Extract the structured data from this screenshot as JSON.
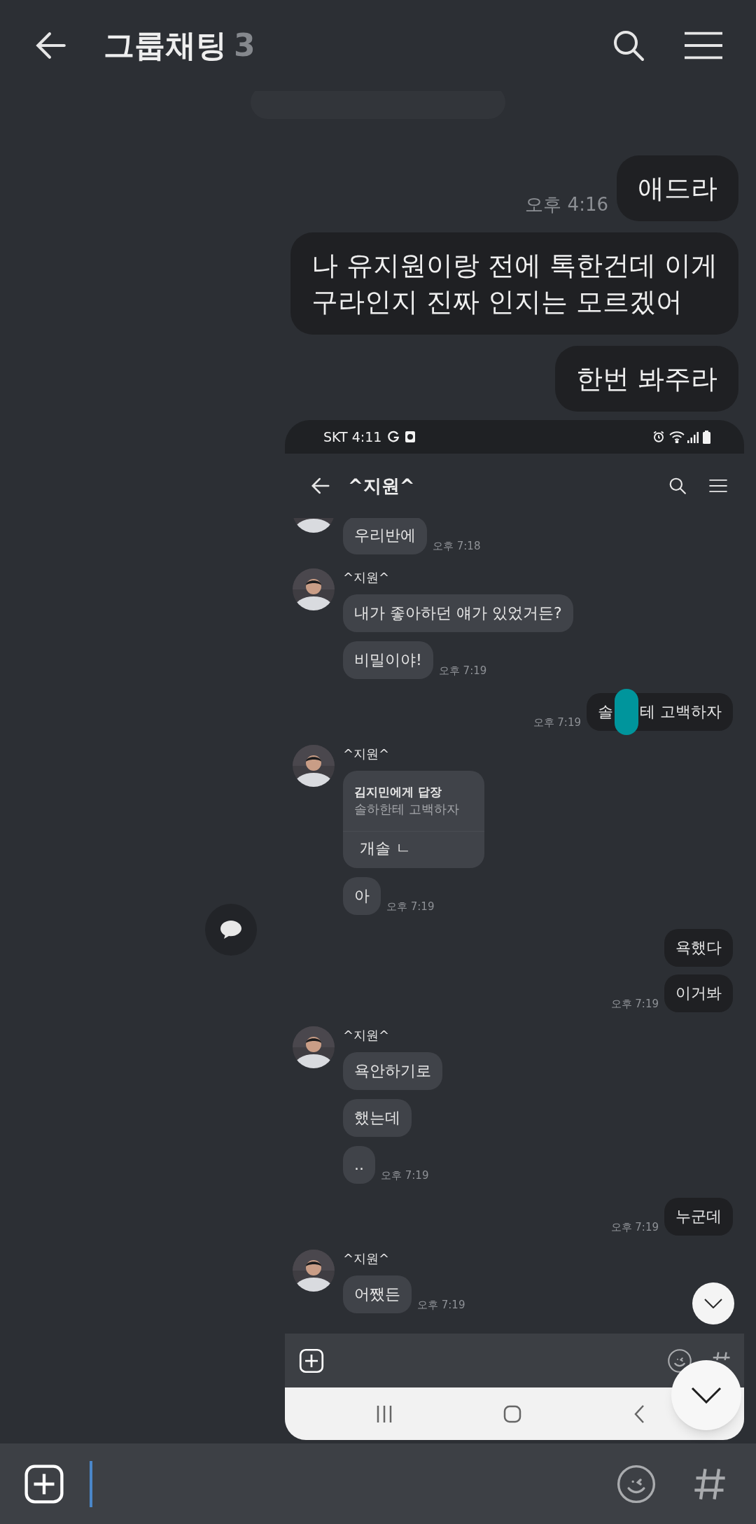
{
  "header": {
    "title": "그룹채팅",
    "member_count": "3"
  },
  "messages": [
    {
      "text": "애드라",
      "time": "오후 4:16"
    },
    {
      "lines": [
        "나 유지원이랑 전에 톡한건데 이게",
        "구라인지 진짜 인지는 모르겠어"
      ]
    },
    {
      "text": "한번 봐주라"
    }
  ],
  "screenshot": {
    "status_bar": {
      "text": "SKT 4:11"
    },
    "header": {
      "title": "^지원^"
    },
    "groups": [
      {
        "kind": "incoming",
        "cut_top": true,
        "bubbles": [
          {
            "kind": "text",
            "text": "우리반에"
          }
        ],
        "time": "오후 7:18"
      },
      {
        "kind": "incoming",
        "name": "^지원^",
        "bubbles": [
          {
            "kind": "text",
            "text": "내가 좋아하던 얘가 있었거든?"
          },
          {
            "kind": "text",
            "text": "비밀이야!"
          }
        ],
        "time": "오후 7:19"
      },
      {
        "kind": "outgoing",
        "bubbles": [
          {
            "kind": "redacted",
            "parts": [
              "솔",
              "테 고백하자"
            ]
          }
        ],
        "time": "오후 7:19"
      },
      {
        "kind": "incoming",
        "name": "^지원^",
        "bubbles": [
          {
            "kind": "reply",
            "reply_to": "김지민에게 답장",
            "quote": "솔하한테 고백하자",
            "text": "개솔 ㄴ"
          },
          {
            "kind": "text",
            "text": "아"
          }
        ],
        "time": "오후 7:19"
      },
      {
        "kind": "outgoing",
        "bubbles": [
          {
            "kind": "text",
            "text": "욕했다"
          },
          {
            "kind": "text",
            "text": "이거봐"
          }
        ],
        "time": "오후 7:19"
      },
      {
        "kind": "incoming",
        "name": "^지원^",
        "bubbles": [
          {
            "kind": "text",
            "text": "욕안하기로"
          },
          {
            "kind": "text",
            "text": "했는데"
          },
          {
            "kind": "text",
            "text": ".."
          }
        ],
        "time": "오후 7:19"
      },
      {
        "kind": "outgoing",
        "bubbles": [
          {
            "kind": "text",
            "text": "누군데"
          }
        ],
        "time": "오후 7:19"
      },
      {
        "kind": "incoming",
        "name": "^지원^",
        "bubbles": [
          {
            "kind": "text",
            "text": "어쨌든"
          }
        ],
        "time": "오후 7:19"
      }
    ]
  }
}
